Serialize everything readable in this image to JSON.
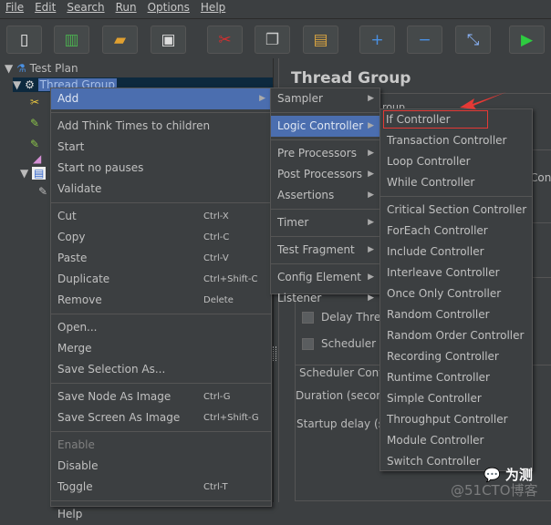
{
  "menubar": [
    "File",
    "Edit",
    "Search",
    "Run",
    "Options",
    "Help"
  ],
  "toolbar": [
    {
      "icon": "new-file-icon"
    },
    {
      "icon": "templates-icon"
    },
    {
      "icon": "open-folder-icon"
    },
    {
      "icon": "save-icon"
    },
    {
      "icon": "cut-icon"
    },
    {
      "icon": "copy-icon"
    },
    {
      "icon": "paste-icon"
    },
    {
      "icon": "expand-plus-icon"
    },
    {
      "icon": "collapse-minus-icon"
    },
    {
      "icon": "toggle-icon"
    },
    {
      "icon": "start-play-icon"
    }
  ],
  "tree": {
    "test_plan": "Test Plan",
    "thread_group": "Thread Group"
  },
  "right": {
    "title": "Thread Group",
    "group_partial": "roup",
    "cont_partial": "Cont",
    "delay": "Delay Threa",
    "scheduler": "Scheduler",
    "scheduler_config": "Scheduler Confi",
    "duration": "Duration (secon",
    "startup": "Startup delay (se"
  },
  "context_menu": [
    {
      "label": "Add",
      "arrow": true,
      "highlight": true
    },
    {
      "sep": true
    },
    {
      "label": "Add Think Times to children"
    },
    {
      "label": "Start"
    },
    {
      "label": "Start no pauses"
    },
    {
      "label": "Validate"
    },
    {
      "sep": true
    },
    {
      "label": "Cut",
      "shortcut": "Ctrl-X"
    },
    {
      "label": "Copy",
      "shortcut": "Ctrl-C"
    },
    {
      "label": "Paste",
      "shortcut": "Ctrl-V"
    },
    {
      "label": "Duplicate",
      "shortcut": "Ctrl+Shift-C"
    },
    {
      "label": "Remove",
      "shortcut": "Delete"
    },
    {
      "sep": true
    },
    {
      "label": "Open..."
    },
    {
      "label": "Merge"
    },
    {
      "label": "Save Selection As..."
    },
    {
      "sep": true
    },
    {
      "label": "Save Node As Image",
      "shortcut": "Ctrl-G"
    },
    {
      "label": "Save Screen As Image",
      "shortcut": "Ctrl+Shift-G"
    },
    {
      "sep": true
    },
    {
      "label": "Enable",
      "disabled": true
    },
    {
      "label": "Disable"
    },
    {
      "label": "Toggle",
      "shortcut": "Ctrl-T"
    },
    {
      "sep": true
    },
    {
      "label": "Help"
    }
  ],
  "add_menu": [
    {
      "label": "Sampler",
      "arrow": true
    },
    {
      "sep": true
    },
    {
      "label": "Logic Controller",
      "arrow": true,
      "highlight": true
    },
    {
      "sep": true
    },
    {
      "label": "Pre Processors",
      "arrow": true
    },
    {
      "label": "Post Processors",
      "arrow": true
    },
    {
      "label": "Assertions",
      "arrow": true
    },
    {
      "sep": true
    },
    {
      "label": "Timer",
      "arrow": true
    },
    {
      "sep": true
    },
    {
      "label": "Test Fragment",
      "arrow": true
    },
    {
      "sep": true
    },
    {
      "label": "Config Element",
      "arrow": true
    },
    {
      "label": "Listener",
      "arrow": true
    }
  ],
  "logic_menu": [
    {
      "label": "If Controller",
      "boxed": true
    },
    {
      "label": "Transaction Controller"
    },
    {
      "label": "Loop Controller"
    },
    {
      "label": "While Controller"
    },
    {
      "sep": true
    },
    {
      "label": "Critical Section Controller"
    },
    {
      "label": "ForEach Controller"
    },
    {
      "label": "Include Controller"
    },
    {
      "label": "Interleave Controller"
    },
    {
      "label": "Once Only Controller"
    },
    {
      "label": "Random Controller"
    },
    {
      "label": "Random Order Controller"
    },
    {
      "label": "Recording Controller"
    },
    {
      "label": "Runtime Controller"
    },
    {
      "label": "Simple Controller"
    },
    {
      "label": "Throughput Controller"
    },
    {
      "label": "Module Controller"
    },
    {
      "label": "Switch Controller"
    }
  ],
  "watermark": {
    "brand": "为测",
    "site": "@51CTO博客"
  },
  "colors": {
    "highlight": "#4b6eaf",
    "annotation": "#e53935"
  }
}
